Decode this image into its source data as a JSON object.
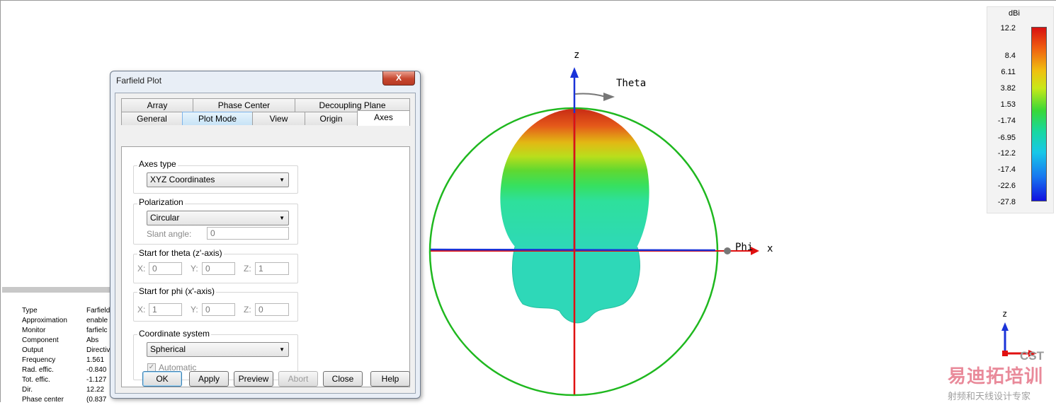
{
  "dialog": {
    "title": "Farfield Plot",
    "close_glyph": "X",
    "tabs_row1": [
      "Array",
      "Phase Center",
      "Decoupling Plane"
    ],
    "tabs_row2": [
      "General",
      "Plot Mode",
      "View",
      "Origin",
      "Axes"
    ],
    "active_tab": "Axes",
    "axes_type": {
      "label": "Axes type",
      "value": "XYZ Coordinates"
    },
    "polarization": {
      "label": "Polarization",
      "value": "Circular",
      "slant_label": "Slant angle:",
      "slant_value": "0"
    },
    "theta": {
      "label": "Start for theta (z'-axis)",
      "x_label": "X:",
      "x": "0",
      "y_label": "Y:",
      "y": "0",
      "z_label": "Z:",
      "z": "1"
    },
    "phi": {
      "label": "Start for phi (x'-axis)",
      "x_label": "X:",
      "x": "1",
      "y_label": "Y:",
      "y": "0",
      "z_label": "Z:",
      "z": "0"
    },
    "coord": {
      "label": "Coordinate system",
      "value": "Spherical",
      "auto_label": "Automatic",
      "auto_checked": true
    },
    "buttons": {
      "ok": "OK",
      "apply": "Apply",
      "preview": "Preview",
      "abort": "Abort",
      "close": "Close",
      "help": "Help"
    }
  },
  "info": {
    "rows": [
      {
        "key": "Type",
        "value": "Farfield"
      },
      {
        "key": "Approximation",
        "value": "enable"
      },
      {
        "key": "Monitor",
        "value": "farfielc"
      },
      {
        "key": "Component",
        "value": "Abs"
      },
      {
        "key": "Output",
        "value": "Directiv"
      },
      {
        "key": "Frequency",
        "value": "1.561"
      },
      {
        "key": "Rad. effic.",
        "value": "-0.840"
      },
      {
        "key": "Tot. effic.",
        "value": "-1.127"
      },
      {
        "key": "Dir.",
        "value": "12.22"
      },
      {
        "key": "Phase center",
        "value": "(0.837"
      }
    ]
  },
  "scene": {
    "axis_z": "z",
    "axis_theta": "Theta",
    "axis_phi": "Phi",
    "axis_x": "x",
    "mini_axis_z": "z",
    "colors": {
      "x_axis": "#e01010",
      "z_axis": "#1a33d8",
      "sphere_outline": "#1fb81f"
    }
  },
  "colorbar": {
    "unit": "dBi",
    "ticks": [
      "12.2",
      "8.4",
      "6.11",
      "3.82",
      "1.53",
      "-1.74",
      "-6.95",
      "-12.2",
      "-17.4",
      "-22.6",
      "-27.8"
    ]
  },
  "watermark": {
    "brand": "CST",
    "cn_title": "易迪拓培训",
    "cn_subtitle": "射频和天线设计专家"
  }
}
